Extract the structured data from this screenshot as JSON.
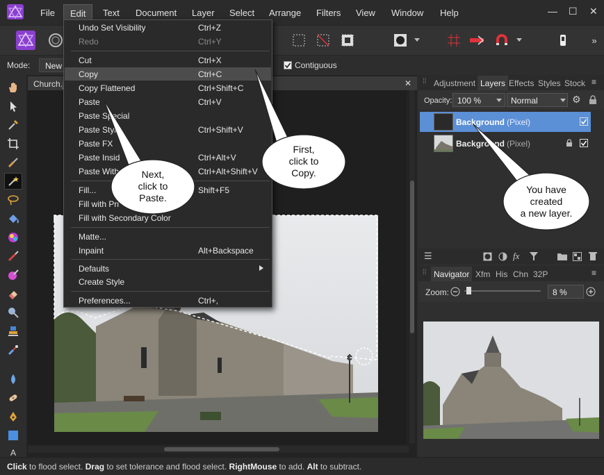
{
  "menubar": {
    "items": [
      "File",
      "Edit",
      "Text",
      "Document",
      "Layer",
      "Select",
      "Arrange",
      "Filters",
      "View",
      "Window",
      "Help"
    ],
    "active": "Edit"
  },
  "contextbar": {
    "mode_label": "Mode:",
    "mode_value": "New",
    "contiguous_label": "Contiguous",
    "contiguous_checked": true
  },
  "document": {
    "tab_title": "Church.jp",
    "close_glyph": "✕"
  },
  "edit_menu": {
    "items": [
      {
        "label": "Undo Set Visibility",
        "shortcut": "Ctrl+Z"
      },
      {
        "label": "Redo",
        "shortcut": "Ctrl+Y",
        "disabled": true
      },
      {
        "label": "Cut",
        "shortcut": "Ctrl+X"
      },
      {
        "label": "Copy",
        "shortcut": "Ctrl+C",
        "highlighted": true
      },
      {
        "label": "Copy Flattened",
        "shortcut": "Ctrl+Shift+C"
      },
      {
        "label": "Paste",
        "shortcut": "Ctrl+V"
      },
      {
        "label": "Paste Special",
        "shortcut": ""
      },
      {
        "label": "Paste Style",
        "shortcut": "Ctrl+Shift+V"
      },
      {
        "label": "Paste FX",
        "shortcut": ""
      },
      {
        "label": "Paste Insid",
        "shortcut": "Ctrl+Alt+V"
      },
      {
        "label": "Paste Withe",
        "shortcut": "Ctrl+Alt+Shift+V"
      },
      {
        "label": "Fill...",
        "shortcut": "Shift+F5"
      },
      {
        "label": "Fill with Pri",
        "shortcut": ""
      },
      {
        "label": "Fill with Secondary Color",
        "shortcut": ""
      },
      {
        "label": "Matte...",
        "shortcut": ""
      },
      {
        "label": "Inpaint",
        "shortcut": "Alt+Backspace"
      },
      {
        "label": "Defaults",
        "shortcut": "",
        "submenu": true
      },
      {
        "label": "Create Style",
        "shortcut": ""
      },
      {
        "label": "Preferences...",
        "shortcut": "Ctrl+,"
      }
    ]
  },
  "layers_panel": {
    "tabs": [
      "Adjustment",
      "Layers",
      "Effects",
      "Styles",
      "Stock"
    ],
    "active_tab": "Layers",
    "opacity_label": "Opacity:",
    "opacity_value": "100 %",
    "blend_mode": "Normal",
    "layers": [
      {
        "name": "Background",
        "type": "(Pixel)",
        "selected": true,
        "locked": false,
        "visible": true
      },
      {
        "name": "Background",
        "type": "(Pixel)",
        "selected": false,
        "locked": true,
        "visible": true
      }
    ]
  },
  "navigator_panel": {
    "tabs": [
      "Navigator",
      "Xfm",
      "His",
      "Chn",
      "32P"
    ],
    "active_tab": "Navigator",
    "zoom_label": "Zoom:",
    "zoom_value": "8 %"
  },
  "callouts": {
    "copy": "First,\nclick to\nCopy.",
    "paste": "Next,\nclick to\nPaste.",
    "layer": "You have\ncreated\na new layer."
  },
  "statusbar": {
    "parts": [
      {
        "text": "Click",
        "bold": true
      },
      {
        "text": " to flood select. ",
        "bold": false
      },
      {
        "text": "Drag",
        "bold": true
      },
      {
        "text": " to set tolerance and flood select. ",
        "bold": false
      },
      {
        "text": "RightMouse",
        "bold": true
      },
      {
        "text": " to add. ",
        "bold": false
      },
      {
        "text": "Alt",
        "bold": true
      },
      {
        "text": " to subtract.",
        "bold": false
      }
    ]
  },
  "colors": {
    "accent_purple": "#7b3fc4",
    "selected_layer": "#5b8fd6",
    "menu_highlight": "#4c4c4c"
  }
}
